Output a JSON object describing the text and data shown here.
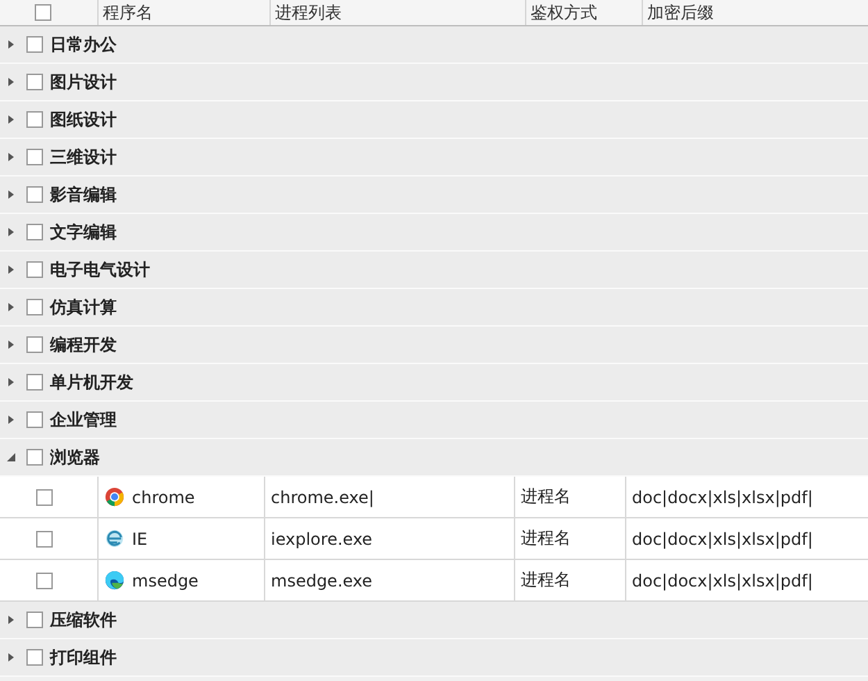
{
  "table": {
    "header_checkbox": {
      "checked": false
    },
    "columns": [
      "程序名",
      "进程列表",
      "鉴权方式",
      "加密后缀"
    ],
    "groups": [
      {
        "name": "日常办公",
        "checked": false,
        "expanded": false
      },
      {
        "name": "图片设计",
        "checked": false,
        "expanded": false
      },
      {
        "name": "图纸设计",
        "checked": false,
        "expanded": false
      },
      {
        "name": "三维设计",
        "checked": false,
        "expanded": false
      },
      {
        "name": "影音编辑",
        "checked": false,
        "expanded": false
      },
      {
        "name": "文字编辑",
        "checked": false,
        "expanded": false
      },
      {
        "name": "电子电气设计",
        "checked": false,
        "expanded": false
      },
      {
        "name": "仿真计算",
        "checked": false,
        "expanded": false
      },
      {
        "name": "编程开发",
        "checked": false,
        "expanded": false
      },
      {
        "name": "单片机开发",
        "checked": false,
        "expanded": false
      },
      {
        "name": "企业管理",
        "checked": false,
        "expanded": false
      },
      {
        "name": "浏览器",
        "checked": false,
        "expanded": true,
        "children": [
          {
            "kind": "chrome",
            "name": "chrome",
            "process": "chrome.exe|",
            "auth": "进程名",
            "suffix": "doc|docx|xls|xlsx|pdf|",
            "checked": false
          },
          {
            "kind": "ie",
            "name": "IE",
            "process": "iexplore.exe",
            "auth": "进程名",
            "suffix": "doc|docx|xls|xlsx|pdf|",
            "checked": false
          },
          {
            "kind": "edge",
            "name": "msedge",
            "process": "msedge.exe",
            "auth": "进程名",
            "suffix": "doc|docx|xls|xlsx|pdf|",
            "checked": false
          }
        ]
      },
      {
        "name": "压缩软件",
        "checked": false,
        "expanded": false
      },
      {
        "name": "打印组件",
        "checked": false,
        "expanded": false
      }
    ]
  }
}
